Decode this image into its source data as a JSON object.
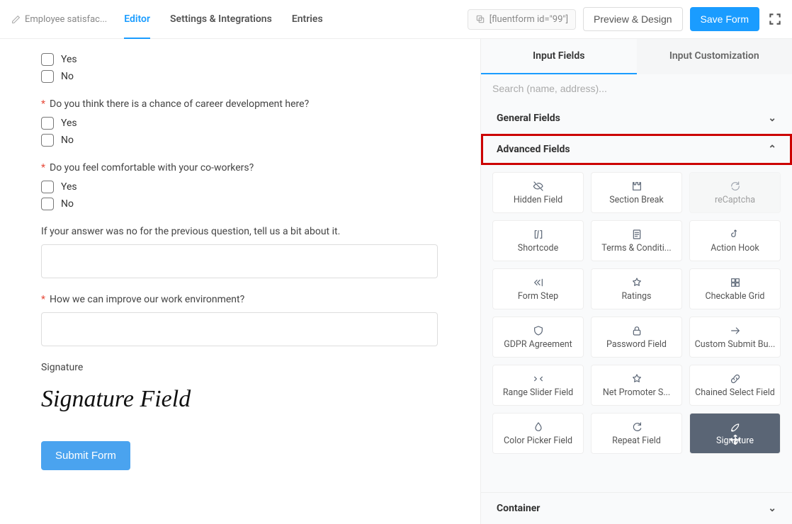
{
  "header": {
    "form_name": "Employee satisfac...",
    "tabs": {
      "editor": "Editor",
      "settings": "Settings & Integrations",
      "entries": "Entries"
    },
    "shortcode": "[fluentform id=\"99\"]",
    "preview": "Preview & Design",
    "save": "Save Form"
  },
  "canvas": {
    "q0": {
      "yes": "Yes",
      "no": "No"
    },
    "q1": {
      "label": "Do you think there is a chance of career development here?",
      "yes": "Yes",
      "no": "No"
    },
    "q2": {
      "label": "Do you feel comfortable with your co-workers?",
      "yes": "Yes",
      "no": "No"
    },
    "q3": {
      "label": "If your answer was no for the previous question, tell us a bit about it."
    },
    "q4": {
      "label": "How we can improve our work environment?"
    },
    "signature": {
      "label": "Signature",
      "placeholder": "Signature Field"
    },
    "submit": "Submit Form"
  },
  "sidebar": {
    "tabs": {
      "input": "Input Fields",
      "custom": "Input Customization"
    },
    "search_placeholder": "Search (name, address)...",
    "sections": {
      "general": "General Fields",
      "advanced": "Advanced Fields",
      "container": "Container"
    },
    "advanced_fields": [
      {
        "name": "hidden-field",
        "label": "Hidden Field",
        "icon": "eye-off"
      },
      {
        "name": "section-break",
        "label": "Section Break",
        "icon": "puzzle"
      },
      {
        "name": "recaptcha",
        "label": "reCaptcha",
        "icon": "refresh",
        "disabled": true
      },
      {
        "name": "shortcode",
        "label": "Shortcode",
        "icon": "brackets"
      },
      {
        "name": "terms-conditions",
        "label": "Terms & Conditi...",
        "icon": "doc"
      },
      {
        "name": "action-hook",
        "label": "Action Hook",
        "icon": "hook"
      },
      {
        "name": "form-step",
        "label": "Form Step",
        "icon": "step"
      },
      {
        "name": "ratings",
        "label": "Ratings",
        "icon": "star"
      },
      {
        "name": "checkable-grid",
        "label": "Checkable Grid",
        "icon": "grid"
      },
      {
        "name": "gdpr-agreement",
        "label": "GDPR Agreement",
        "icon": "shield"
      },
      {
        "name": "password-field",
        "label": "Password Field",
        "icon": "lock"
      },
      {
        "name": "custom-submit",
        "label": "Custom Submit Bu...",
        "icon": "arrow"
      },
      {
        "name": "range-slider",
        "label": "Range Slider Field",
        "icon": "slider"
      },
      {
        "name": "net-promoter",
        "label": "Net Promoter S...",
        "icon": "star"
      },
      {
        "name": "chained-select",
        "label": "Chained Select Field",
        "icon": "link"
      },
      {
        "name": "color-picker",
        "label": "Color Picker Field",
        "icon": "drop"
      },
      {
        "name": "repeat-field",
        "label": "Repeat Field",
        "icon": "repeat"
      },
      {
        "name": "signature",
        "label": "Signature",
        "icon": "pen",
        "dragging": true
      }
    ]
  }
}
